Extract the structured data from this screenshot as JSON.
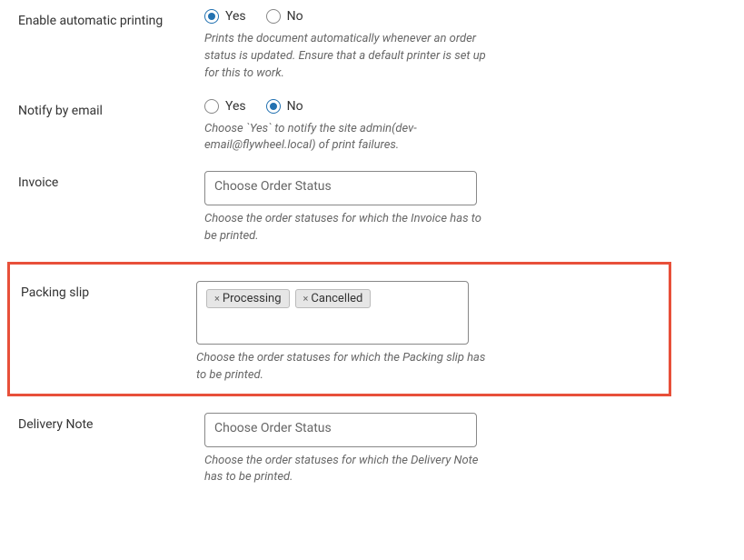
{
  "auto_print": {
    "label": "Enable automatic printing",
    "yes": "Yes",
    "no": "No",
    "selected": "yes",
    "help": "Prints the document automatically whenever an order status is updated. Ensure that a default printer is set up for this to work."
  },
  "notify_email": {
    "label": "Notify by email",
    "yes": "Yes",
    "no": "No",
    "selected": "no",
    "help": "Choose `Yes` to notify the site admin(dev-email@flywheel.local) of print failures."
  },
  "invoice": {
    "label": "Invoice",
    "placeholder": "Choose Order Status",
    "help": "Choose the order statuses for which the Invoice has to be printed."
  },
  "packing_slip": {
    "label": "Packing slip",
    "tags": [
      "Processing",
      "Cancelled"
    ],
    "help": "Choose the order statuses for which the Packing slip has to be printed."
  },
  "delivery_note": {
    "label": "Delivery Note",
    "placeholder": "Choose Order Status",
    "help": "Choose the order statuses for which the Delivery Note has to be printed."
  }
}
